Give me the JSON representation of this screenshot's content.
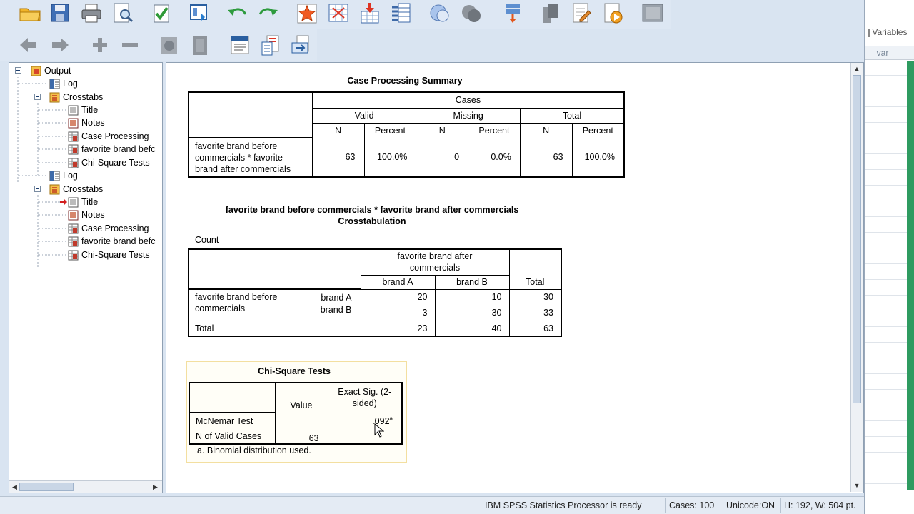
{
  "tree": {
    "items": [
      {
        "label": "Output",
        "icon": "output-icon"
      },
      {
        "label": "Log",
        "icon": "log-icon"
      },
      {
        "label": "Crosstabs",
        "icon": "procedure-icon"
      },
      {
        "label": "Title",
        "icon": "title-icon"
      },
      {
        "label": "Notes",
        "icon": "notes-icon"
      },
      {
        "label": "Case Processing",
        "icon": "table-icon"
      },
      {
        "label": "favorite brand befc",
        "icon": "table-icon"
      },
      {
        "label": "Chi-Square Tests",
        "icon": "table-icon"
      },
      {
        "label": "Log",
        "icon": "log-icon"
      },
      {
        "label": "Crosstabs",
        "icon": "procedure-icon"
      },
      {
        "label": "Title",
        "icon": "title-icon"
      },
      {
        "label": "Notes",
        "icon": "notes-icon"
      },
      {
        "label": "Case Processing",
        "icon": "table-icon"
      },
      {
        "label": "favorite brand befc",
        "icon": "table-icon"
      },
      {
        "label": "Chi-Square Tests",
        "icon": "table-icon"
      }
    ]
  },
  "data_editor": {
    "variables_label": "Variables",
    "col_header": "var"
  },
  "case_summary": {
    "title": "Case Processing Summary",
    "cases_label": "Cases",
    "groups": [
      "Valid",
      "Missing",
      "Total"
    ],
    "sub": [
      "N",
      "Percent"
    ],
    "row_label": "favorite brand before commercials * favorite brand after commercials",
    "row_label_lines": [
      "favorite brand before",
      "commercials * favorite",
      "brand after commercials"
    ],
    "values": [
      "63",
      "100.0%",
      "0",
      "0.0%",
      "63",
      "100.0%"
    ]
  },
  "crosstab": {
    "title_line1": "favorite brand before commercials * favorite brand after commercials",
    "title_line2": "Crosstabulation",
    "count_label": "Count",
    "col_header_line1": "favorite brand after",
    "col_header_line2": "commercials",
    "columns": [
      "brand A",
      "brand B"
    ],
    "total_label": "Total",
    "row_var_line1": "favorite brand before",
    "row_var_line2": "commercials",
    "rows": [
      {
        "label": "brand A",
        "values": [
          "20",
          "10",
          "30"
        ]
      },
      {
        "label": "brand B",
        "values": [
          "3",
          "30",
          "33"
        ]
      }
    ],
    "total_row": {
      "label": "Total",
      "values": [
        "23",
        "40",
        "63"
      ]
    }
  },
  "chi_square": {
    "title": "Chi-Square Tests",
    "col_value": "Value",
    "col_sig_line1": "Exact Sig. (2-",
    "col_sig_line2": "sided)",
    "mcnemar_label": "McNemar Test",
    "mcnemar_sig": ".092",
    "mcnemar_sup": "a",
    "valid_label": "N of Valid Cases",
    "valid_value": "63",
    "footnote": "a. Binomial distribution used."
  },
  "status": {
    "processor": "IBM SPSS Statistics Processor is ready",
    "cases": "Cases: 100",
    "unicode": "Unicode:ON",
    "dims": "H: 192, W: 504 pt."
  },
  "colors": {
    "accent": "#1f5fa8",
    "pane_border": "#8fa0b3",
    "selection_box": "#f3dfa0"
  }
}
